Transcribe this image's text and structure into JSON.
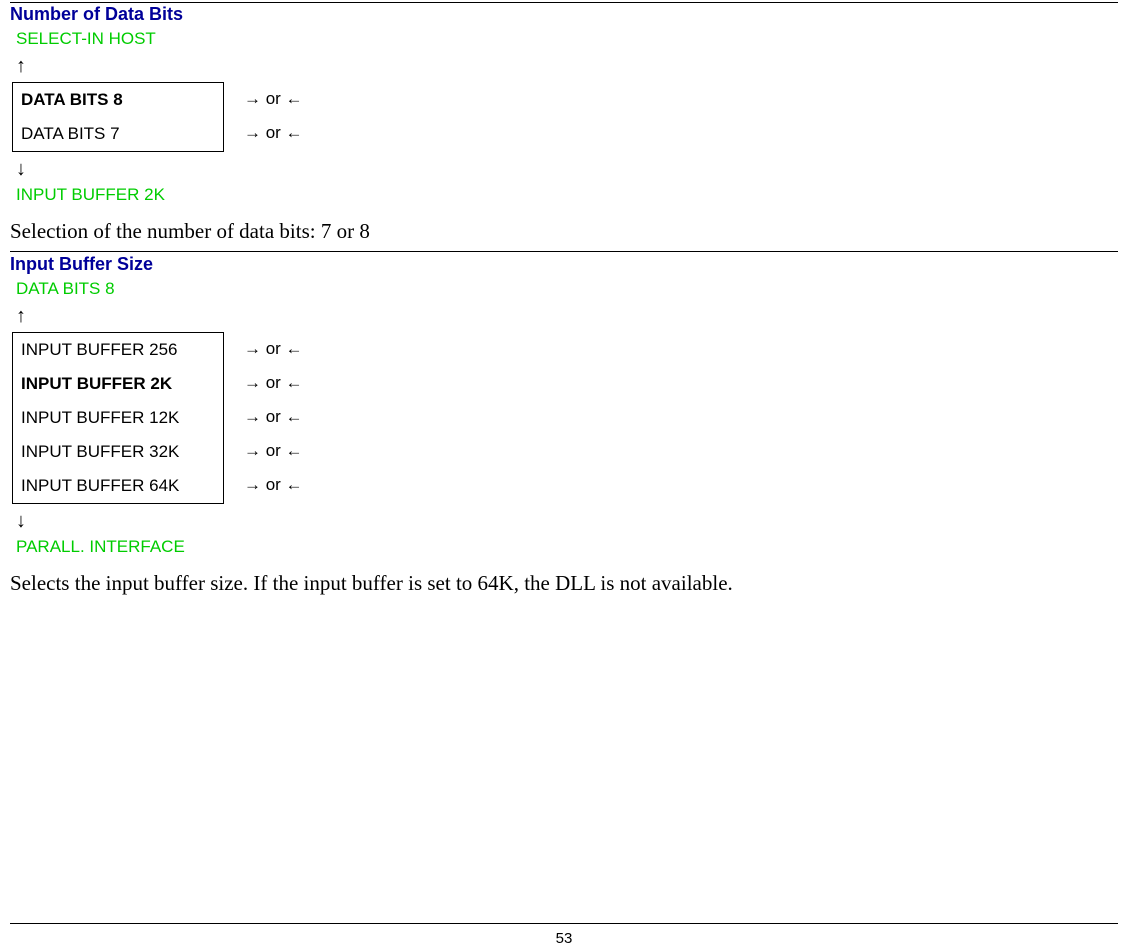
{
  "section1": {
    "title": "Number of Data Bits",
    "prev_menu": "SELECT-IN HOST",
    "arrow_up": "↑",
    "options": [
      {
        "label": "DATA BITS 8",
        "bold": true,
        "nav": "→ or ←"
      },
      {
        "label": "DATA BITS 7",
        "bold": false,
        "nav": "→ or ←"
      }
    ],
    "arrow_down": "↓",
    "next_menu": "INPUT BUFFER 2K",
    "body": "Selection of the number of data bits: 7 or 8"
  },
  "section2": {
    "title": "Input Buffer Size",
    "prev_menu": "DATA BITS 8",
    "arrow_up": "↑",
    "options": [
      {
        "label": "INPUT BUFFER 256",
        "bold": false,
        "nav": "→ or ←"
      },
      {
        "label": "INPUT BUFFER 2K",
        "bold": true,
        "nav": "→ or ←"
      },
      {
        "label": "INPUT BUFFER 12K",
        "bold": false,
        "nav": "→ or ←"
      },
      {
        "label": "INPUT BUFFER 32K",
        "bold": false,
        "nav": "→ or ←"
      },
      {
        "label": "INPUT BUFFER 64K",
        "bold": false,
        "nav": "→ or ←"
      }
    ],
    "arrow_down": "↓",
    "next_menu": "PARALL. INTERFACE",
    "body": "Selects the input buffer size. If the input buffer is set to 64K, the DLL is not available."
  },
  "page_number": "53"
}
